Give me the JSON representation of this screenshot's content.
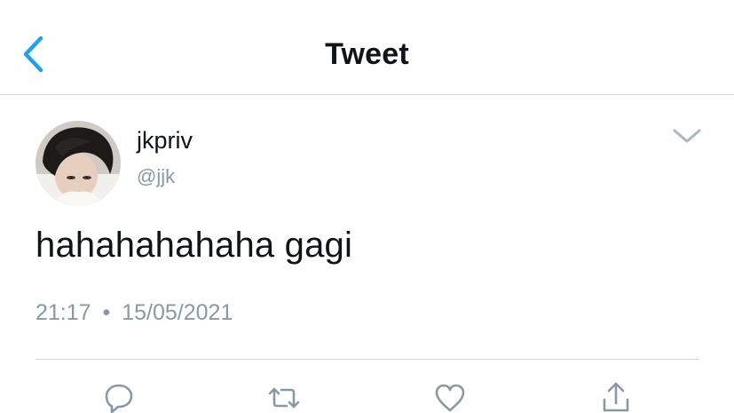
{
  "header": {
    "title": "Tweet"
  },
  "icons": {
    "back": "chevron-left-icon",
    "more": "chevron-down-icon",
    "reply": "reply-icon",
    "retweet": "retweet-icon",
    "like": "heart-icon",
    "share": "share-icon"
  },
  "colors": {
    "accent": "#1da1f2",
    "muted": "#8899a6",
    "divider": "#d6d9dc"
  },
  "tweet": {
    "display_name": "jkpriv",
    "handle": "@jjk",
    "text": "hahahahahaha gagi",
    "time": "21:17",
    "separator": "•",
    "date": "15/05/2021"
  }
}
